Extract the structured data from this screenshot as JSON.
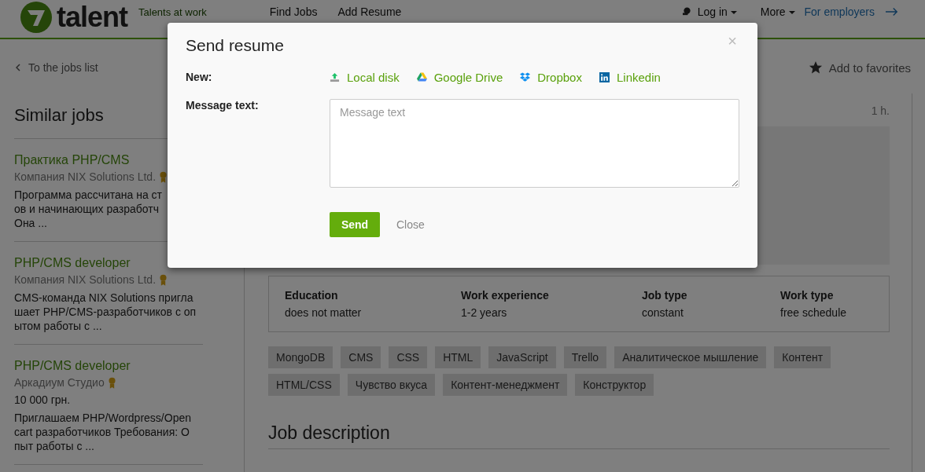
{
  "header": {
    "logo": "talent",
    "tagline": "Talents at work",
    "nav": [
      "Find Jobs",
      "Add Resume"
    ],
    "login": "Log in",
    "more": "More",
    "employers": "For employers"
  },
  "back_link": "To the jobs list",
  "favorite": "Add to favorites",
  "similar": {
    "title": "Similar jobs",
    "items": [
      {
        "title": "Практика PHP/CMS",
        "company": "Компания NIX Solutions Ltd.",
        "verified": true,
        "lines": [
          "Программа рассчитана на ст",
          "ов и начинающих разработч",
          "Она ..."
        ]
      },
      {
        "title": "PHP/CMS developer",
        "company": "Компания NIX Solutions Ltd.",
        "verified": true,
        "lines": [
          "CMS-команда NIX Solutions пригла",
          "шает PHP/CMS-разработчиков с оп",
          "ытом работы с ..."
        ]
      },
      {
        "title": "PHP/CMS developer",
        "company": "Аркадиум Студио",
        "verified": true,
        "salary": "10 000 грн.",
        "lines": [
          "Приглашаем PHP/Wordpress/Open",
          "cart разработчиков Требования: О",
          "пыт работы с ..."
        ]
      }
    ]
  },
  "job": {
    "posted": "1 h.",
    "facts": [
      {
        "label": "Education",
        "value": "does not matter"
      },
      {
        "label": "Work experience",
        "value": "1-2 years"
      },
      {
        "label": "Job type",
        "value": "constant"
      },
      {
        "label": "Work type",
        "value": "free schedule"
      }
    ],
    "tags": [
      "MongoDB",
      "CMS",
      "CSS",
      "HTML",
      "JavaScript",
      "Trello",
      "Аналитическое мышление",
      "Контент",
      "HTML/CSS",
      "Чувство вкуса",
      "Контент-менеджмент",
      "Конструктор"
    ],
    "section_title": "Job description"
  },
  "modal": {
    "title": "Send resume",
    "close": "×",
    "new_label": "New:",
    "sources": [
      {
        "kind": "disk",
        "label": "Local disk"
      },
      {
        "kind": "gdrive",
        "label": "Google Drive"
      },
      {
        "kind": "dropbox",
        "label": "Dropbox"
      },
      {
        "kind": "linkedin",
        "label": "Linkedin"
      }
    ],
    "message_label": "Message text:",
    "message_placeholder": "Message text",
    "send": "Send",
    "cancel": "Close"
  }
}
